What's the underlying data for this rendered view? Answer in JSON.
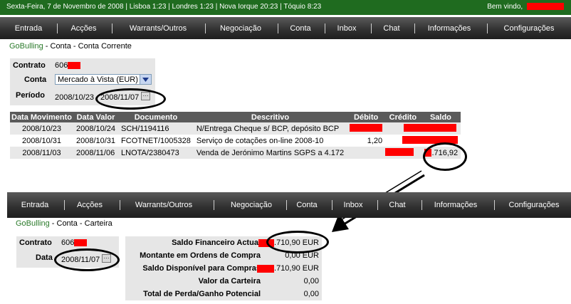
{
  "topbar": {
    "info": "Sexta-Feira, 7 de Novembro de 2008  |  Lisboa 1:23  |  Londres 1:23  |  Nova Iorque 20:23  |  Tóquio 8:23",
    "welcome": "Bem vindo,"
  },
  "nav": [
    "Entrada",
    "Acções",
    "Warrants/Outros",
    "Negociação",
    "Conta",
    "Inbox",
    "Chat",
    "Informações",
    "Configurações"
  ],
  "top": {
    "breadcrumb": {
      "root": "GoBulling",
      "sep1": "-",
      "section": "Conta",
      "sep2": "-",
      "page": "Conta Corrente"
    },
    "contrato_label": "Contrato",
    "contrato_value": "606",
    "conta_label": "Conta",
    "conta_value": "Mercado à Vista (EUR)",
    "periodo_label": "Período",
    "periodo_from": "2008/10/23",
    "periodo_to": "2008/11/07",
    "table": {
      "headers": [
        "Data Movimento",
        "Data Valor",
        "Documento",
        "Descritivo",
        "Débito",
        "Crédito",
        "Saldo"
      ],
      "rows": [
        [
          "2008/10/23",
          "2008/10/24",
          "SCH/1194116",
          "N/Entrega Cheque s/ BCP, depósito BCP",
          "",
          "",
          ""
        ],
        [
          "2008/10/31",
          "2008/10/31",
          "FCOTNET/1005328",
          "Serviço de cotações on-line 2008-10",
          "1,20",
          "",
          ""
        ],
        [
          "2008/11/03",
          "2008/11/06",
          "LNOTA/2380473",
          "Venda de   Jerónimo Martins SGPS a 4.172",
          "",
          "",
          ".716,92"
        ]
      ]
    }
  },
  "bottom": {
    "breadcrumb": {
      "root": "GoBulling",
      "sep1": "-",
      "section": "Conta",
      "sep2": "-",
      "page": "Carteira"
    },
    "contrato_label": "Contrato",
    "contrato_value": "606",
    "data_label": "Data",
    "data_value": "2008/11/07",
    "summary": [
      {
        "label": "Saldo Financeiro Actual",
        "value": ".710,90 EUR"
      },
      {
        "label": "Montante em Ordens de Compra",
        "value": "0,00 EUR"
      },
      {
        "label": "Saldo Disponível para Compras",
        "value": ".710,90 EUR"
      },
      {
        "label": "Valor da Carteira",
        "value": "0,00"
      },
      {
        "label": "Total de Perda/Ganho Potencial",
        "value": "0,00"
      }
    ]
  },
  "colors": {
    "topbar": "#1f6b1f",
    "nav": "#3a3a3a",
    "brand": "#2a7a2a",
    "redaction": "#ff0000",
    "panel": "#e6e6e6"
  }
}
